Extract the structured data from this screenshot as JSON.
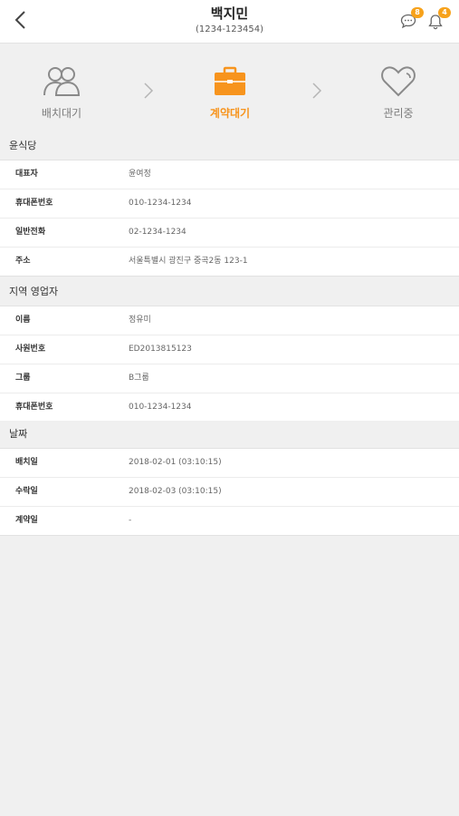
{
  "header": {
    "title": "백지민",
    "subtitle": "(1234-123454)",
    "chat_badge": "8",
    "bell_badge": "4"
  },
  "steps": [
    {
      "label": "배치대기",
      "icon": "people-icon",
      "active": false
    },
    {
      "label": "계약대기",
      "icon": "briefcase-icon",
      "active": true
    },
    {
      "label": "관리중",
      "icon": "heart-icon",
      "active": false
    }
  ],
  "colors": {
    "accent": "#f7941d",
    "badge": "#f7a21b",
    "inactive": "#8a8a8a"
  },
  "sections": [
    {
      "title": "윤식당",
      "rows": [
        {
          "key": "대표자",
          "value": "윤여정"
        },
        {
          "key": "휴대폰번호",
          "value": "010-1234-1234"
        },
        {
          "key": "일반전화",
          "value": "02-1234-1234"
        },
        {
          "key": "주소",
          "value": "서울특별시 광진구 중곡2동 123-1"
        }
      ]
    },
    {
      "title": "지역 영업자",
      "rows": [
        {
          "key": "이름",
          "value": "정유미"
        },
        {
          "key": "사원번호",
          "value": "ED2013815123"
        },
        {
          "key": "그룹",
          "value": "B그룹"
        },
        {
          "key": "휴대폰번호",
          "value": "010-1234-1234"
        }
      ]
    },
    {
      "title": "날짜",
      "rows": [
        {
          "key": "배치일",
          "value": "2018-02-01 (03:10:15)"
        },
        {
          "key": "수락일",
          "value": "2018-02-03 (03:10:15)"
        },
        {
          "key": "계약일",
          "value": "-"
        }
      ]
    }
  ]
}
